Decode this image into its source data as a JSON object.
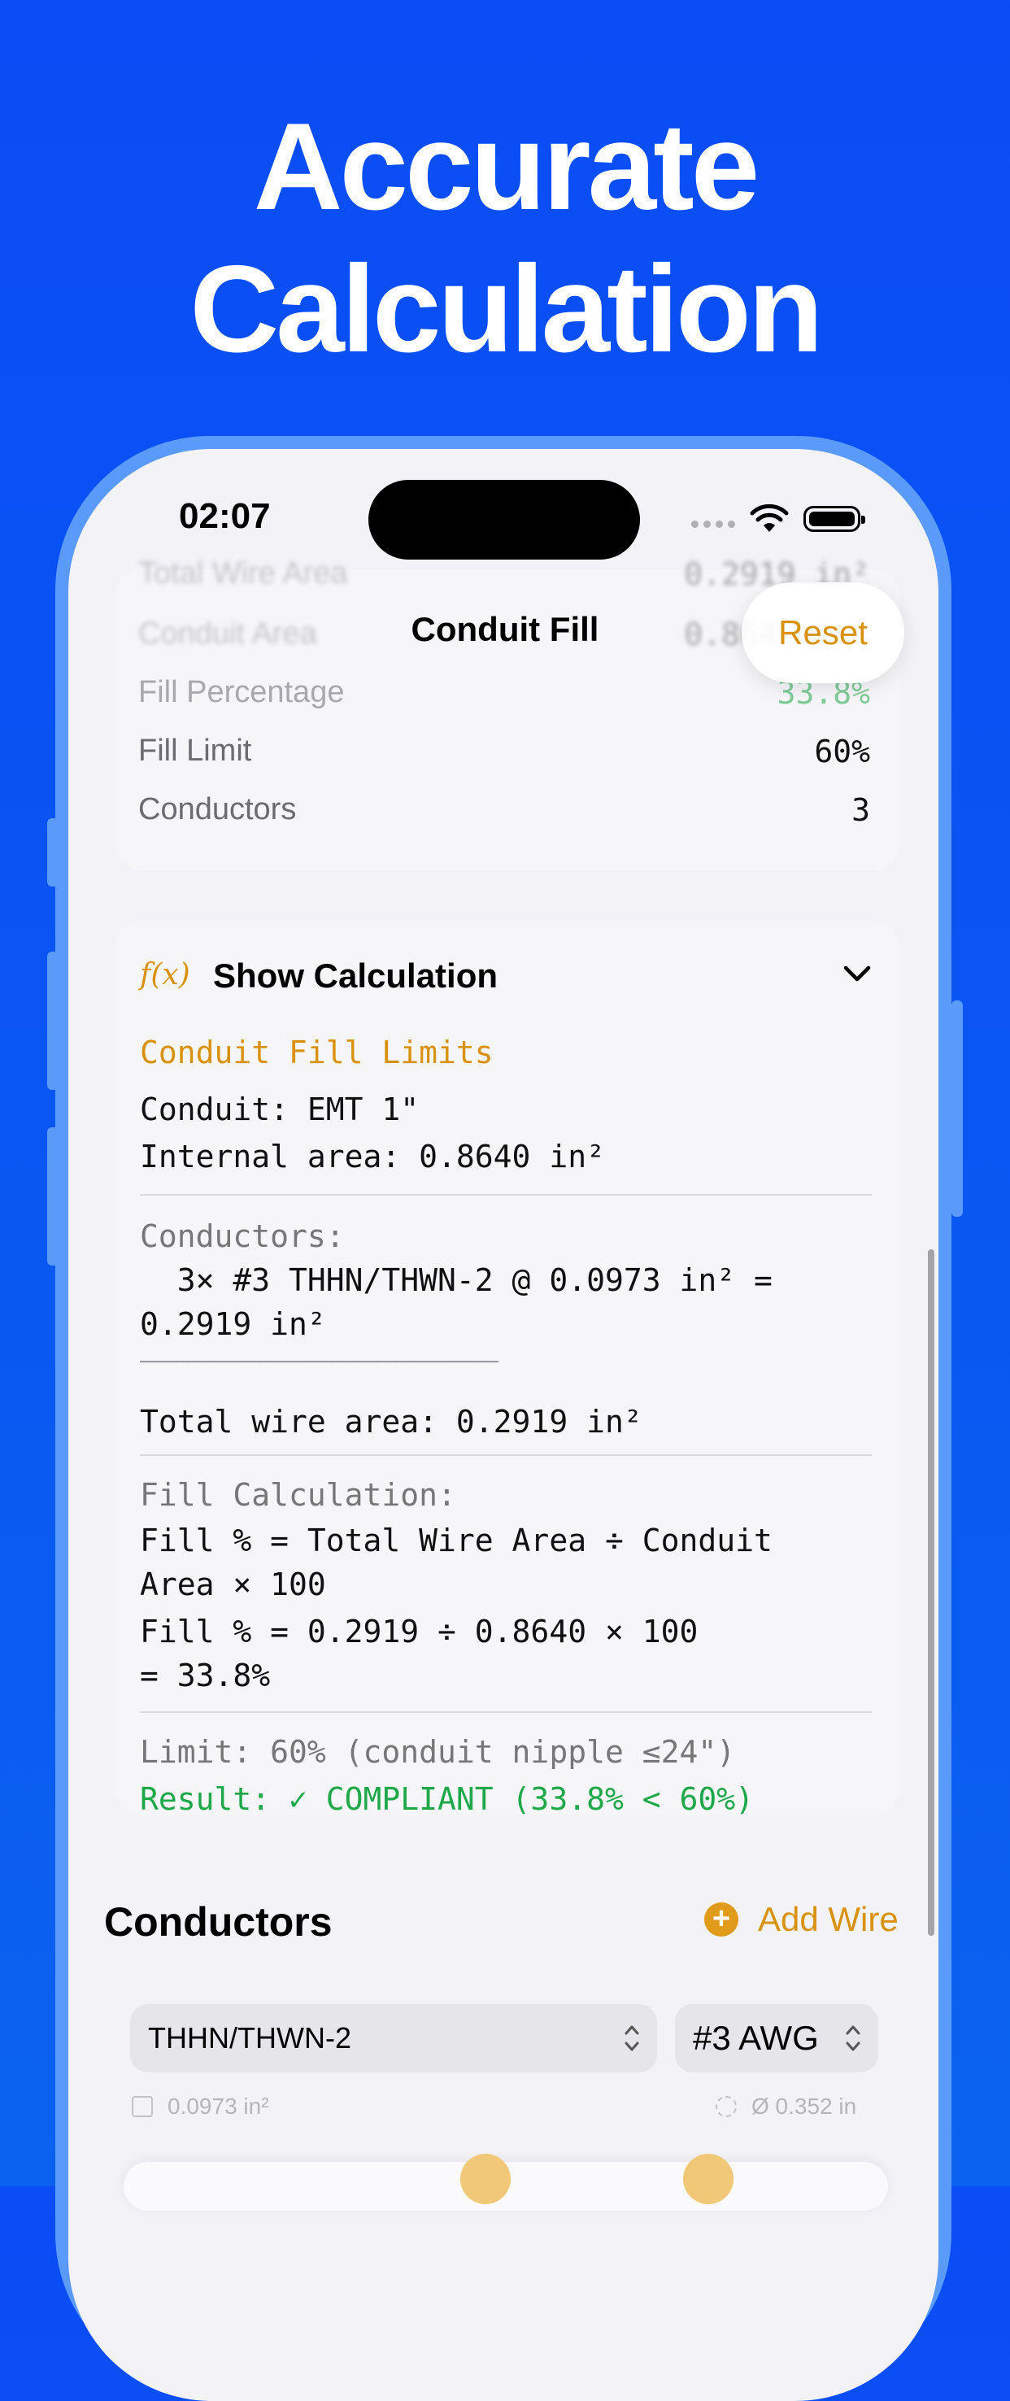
{
  "headline": {
    "line1": "Accurate",
    "line2": "Calculation"
  },
  "status_bar": {
    "time": "02:07"
  },
  "nav": {
    "title": "Conduit Fill",
    "reset_label": "Reset"
  },
  "summary": {
    "rows": [
      {
        "label": "Total Wire Area",
        "value": "0.2919 in²"
      },
      {
        "label": "Conduit Area",
        "value": "0.8640 in²"
      },
      {
        "label": "Fill Percentage",
        "value": "33.8%"
      },
      {
        "label": "Fill Limit",
        "value": "60%"
      },
      {
        "label": "Conductors",
        "value": "3"
      }
    ]
  },
  "calculation": {
    "toggle_icon": "f(x)",
    "toggle_label": "Show Calculation",
    "limits_title": "Conduit Fill Limits",
    "conduit_line": "Conduit: EMT 1\"",
    "internal_area_line": "Internal area: 0.8640 in²",
    "conductors_header": "Conductors:",
    "conductor_line_1": "  3× #3 THHN/THWN-2 @ 0.0973 in² =",
    "conductor_line_2": "0.2919 in²",
    "rule_line": "──────────────────────────────",
    "total_line": "Total wire area: 0.2919 in²",
    "fill_header": "Fill Calculation:",
    "formula_1": "Fill % = Total Wire Area ÷ Conduit",
    "formula_2": "Area × 100",
    "formula_3": "Fill % = 0.2919 ÷ 0.8640 × 100",
    "formula_4": "= 33.8%",
    "limit_line": "Limit: 60% (conduit nipple ≤24\")",
    "result_line": "Result: ✓ COMPLIANT (33.8% < 60%)"
  },
  "conductors_section": {
    "title": "Conductors",
    "add_label": "Add Wire",
    "insulation": "THHN/THWN-2",
    "awg": "#3 AWG",
    "area": "0.0973 in²",
    "diameter": "Ø 0.352 in"
  },
  "colors": {
    "accent": "#d9920f",
    "background": "#0a4cf5",
    "success": "#1ea84a"
  }
}
